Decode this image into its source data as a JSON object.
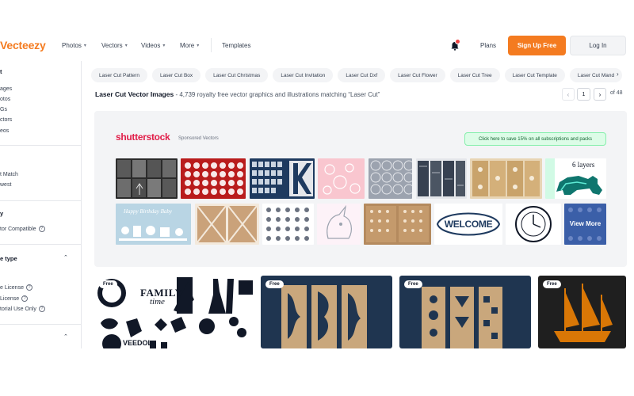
{
  "header": {
    "logo": "Vecteezy",
    "nav": [
      {
        "label": "Photos",
        "has_chevron": true
      },
      {
        "label": "Vectors",
        "has_chevron": true
      },
      {
        "label": "Videos",
        "has_chevron": true
      },
      {
        "label": "More",
        "has_chevron": true
      },
      {
        "label": "Templates",
        "has_chevron": false
      }
    ],
    "plans": "Plans",
    "signup": "Sign Up Free",
    "login": "Log In",
    "accent": "#f47b20"
  },
  "sidebar": {
    "section1_head": "t",
    "section1_items": [
      "ages",
      "otos",
      "Gs",
      "ctors",
      "eos"
    ],
    "section2_head": "",
    "section2_items": [
      "t Match",
      "west"
    ],
    "section3_head": "y",
    "section3_item": "tor Compatible",
    "section4_head": "e type",
    "section4_items": [
      "e License",
      "License",
      "torial Use Only"
    ]
  },
  "chips": [
    "Laser Cut Pattern",
    "Laser Cut Box",
    "Laser Cut Christmas",
    "Laser Cut Invitation",
    "Laser Cut Dxf",
    "Laser Cut Flower",
    "Laser Cut Tree",
    "Laser Cut Template",
    "Laser Cut Mand"
  ],
  "results": {
    "title": "Laser Cut Vector Images",
    "subtitle": " - 4,739 royalty free vector graphics and illustrations matching “Laser Cut”",
    "page": "1",
    "total": "of 48"
  },
  "sponsored": {
    "brand": "shutterstock",
    "label": "Sponsored Vectors",
    "promo": "Click here to save 15% on all subscriptions and packs",
    "thumb_texts": {
      "birthday": "Happy Birthday Baby",
      "welcome": "WELCOME",
      "layers": "6 layers",
      "view_more": "View More"
    },
    "brand_color": "#e11d48"
  },
  "cards": [
    {
      "badge": "Free",
      "text1": "FAMILY",
      "text2": "time",
      "text3": "VEEDOL"
    },
    {
      "badge": "Free"
    },
    {
      "badge": "Free"
    },
    {
      "badge": "Free"
    }
  ]
}
